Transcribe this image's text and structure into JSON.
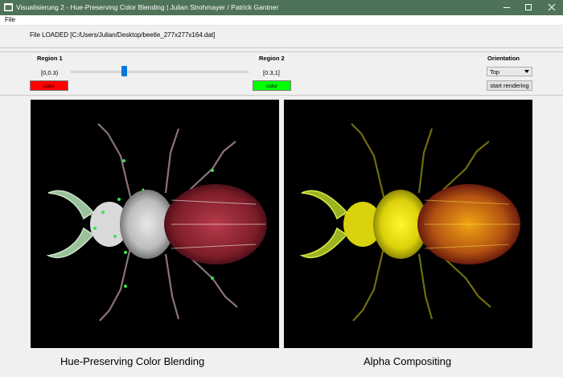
{
  "window": {
    "title": "Visualisierung 2 - Hue-Preserving Color Blending | Julian Strohmayer / Patrick Gantner"
  },
  "menu": {
    "file": "File"
  },
  "status": {
    "file_loaded": "File LOADED [C:/Users/Julian/Desktop/beetle_277x277x164.dat]"
  },
  "region1": {
    "label": "Region 1",
    "range": "[0,0.3)",
    "color_button": "color",
    "color": "#ff0000"
  },
  "region2": {
    "label": "Region 2",
    "range": "[0.3,1]",
    "color_button": "color",
    "color": "#00ff00"
  },
  "slider": {
    "value": 0.3
  },
  "orientation": {
    "label": "Orientation",
    "selected": "Top"
  },
  "actions": {
    "start_rendering": "start rendering"
  },
  "views": {
    "left": {
      "caption": "Hue-Preserving Color Blending"
    },
    "right": {
      "caption": "Alpha Compositing"
    }
  }
}
